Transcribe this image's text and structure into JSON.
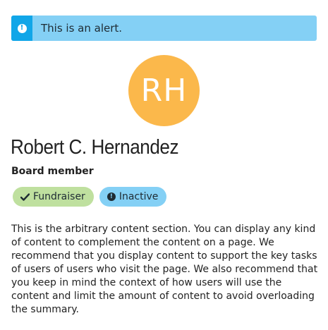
{
  "alert": {
    "icon": "info-circle-icon",
    "text": "This is an alert.",
    "colors": {
      "background": "#84d0f5",
      "accent": "#11a6e8"
    }
  },
  "profile": {
    "initials": "RH",
    "name": "Robert C. Hernandez",
    "role": "Board member",
    "avatar_color": "#fbb84b"
  },
  "badges": [
    {
      "label": "Fundraiser",
      "icon": "check-icon",
      "color": "#bfe09f"
    },
    {
      "label": "Inactive",
      "icon": "info-circle-icon",
      "color": "#84d0f5"
    }
  ],
  "content": {
    "text": "This is the arbitrary content section. You can display any kind of content to complement the content on a page. We recommend that you display content to support the key tasks of users of users who visit the page. We also recommend that you keep in mind the context of how users will use the content and limit the amount of content to avoid overloading the summary."
  }
}
